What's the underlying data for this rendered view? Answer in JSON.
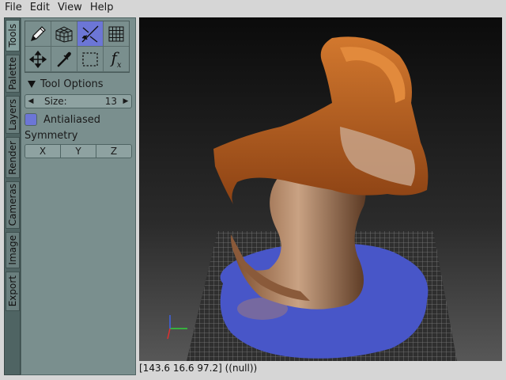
{
  "menubar": {
    "items": [
      "File",
      "Edit",
      "View",
      "Help"
    ]
  },
  "left_tabs": [
    "Tools",
    "Palette",
    "Layers",
    "Render",
    "Cameras",
    "Image",
    "Export"
  ],
  "tools": [
    {
      "name": "pencil-icon"
    },
    {
      "name": "cube-icon"
    },
    {
      "name": "line-icon",
      "selected": true
    },
    {
      "name": "grid-icon"
    },
    {
      "name": "move-icon"
    },
    {
      "name": "eyedropper-icon"
    },
    {
      "name": "select-rect-icon"
    },
    {
      "name": "function-icon",
      "label": "f",
      "sub": "x"
    }
  ],
  "tool_options": {
    "header": "Tool Options",
    "size_label": "Size:",
    "size_value": "13",
    "antialiased_label": "Antialiased",
    "symmetry_label": "Symmetry",
    "symmetry_buttons": [
      "X",
      "Y",
      "Z"
    ]
  },
  "status": {
    "text": "[143.6 16.6 97.2] ((null))"
  },
  "colors": {
    "accent": "#6c76d6",
    "panel": "#7a8f8e",
    "tabs": "#4f6463"
  }
}
